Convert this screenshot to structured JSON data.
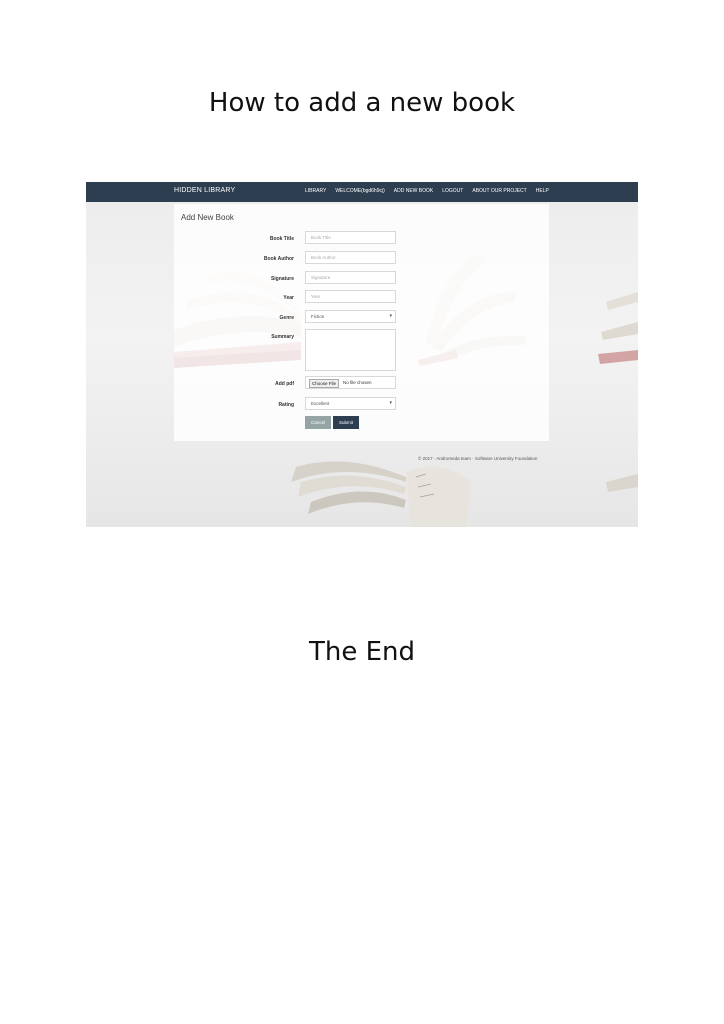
{
  "document": {
    "heading_top": "How to add a new book",
    "heading_bottom": "The End"
  },
  "screenshot": {
    "navbar": {
      "brand": "HIDDEN LIBRARY",
      "links": [
        "LIBRARY",
        "WELCOME(bgd6h9cj)",
        "ADD NEW BOOK",
        "LOGOUT",
        "ABOUT OUR PROJECT",
        "HELP"
      ]
    },
    "form": {
      "title": "Add New Book",
      "fields": [
        {
          "label": "Book Title",
          "placeholder": "Book Title"
        },
        {
          "label": "Book Author",
          "placeholder": "Book Author"
        },
        {
          "label": "Signature",
          "placeholder": "Signature"
        },
        {
          "label": "Year",
          "placeholder": "Year"
        },
        {
          "label": "Genre",
          "value": "Fiction"
        },
        {
          "label": "Summary",
          "value": ""
        }
      ],
      "pdf": {
        "label": "Add pdf",
        "button": "Choose File",
        "status": "No file chosen"
      },
      "rating": {
        "label": "Rating",
        "value": "Excellent"
      },
      "buttons": {
        "cancel": "Cancel",
        "submit": "Submit"
      }
    },
    "footer": "© 2017 · Andromeda team · Software University Foundation",
    "colors": {
      "navbar": "#2d3e50",
      "cancel": "#95a5a6",
      "submit": "#2d3e50"
    }
  }
}
